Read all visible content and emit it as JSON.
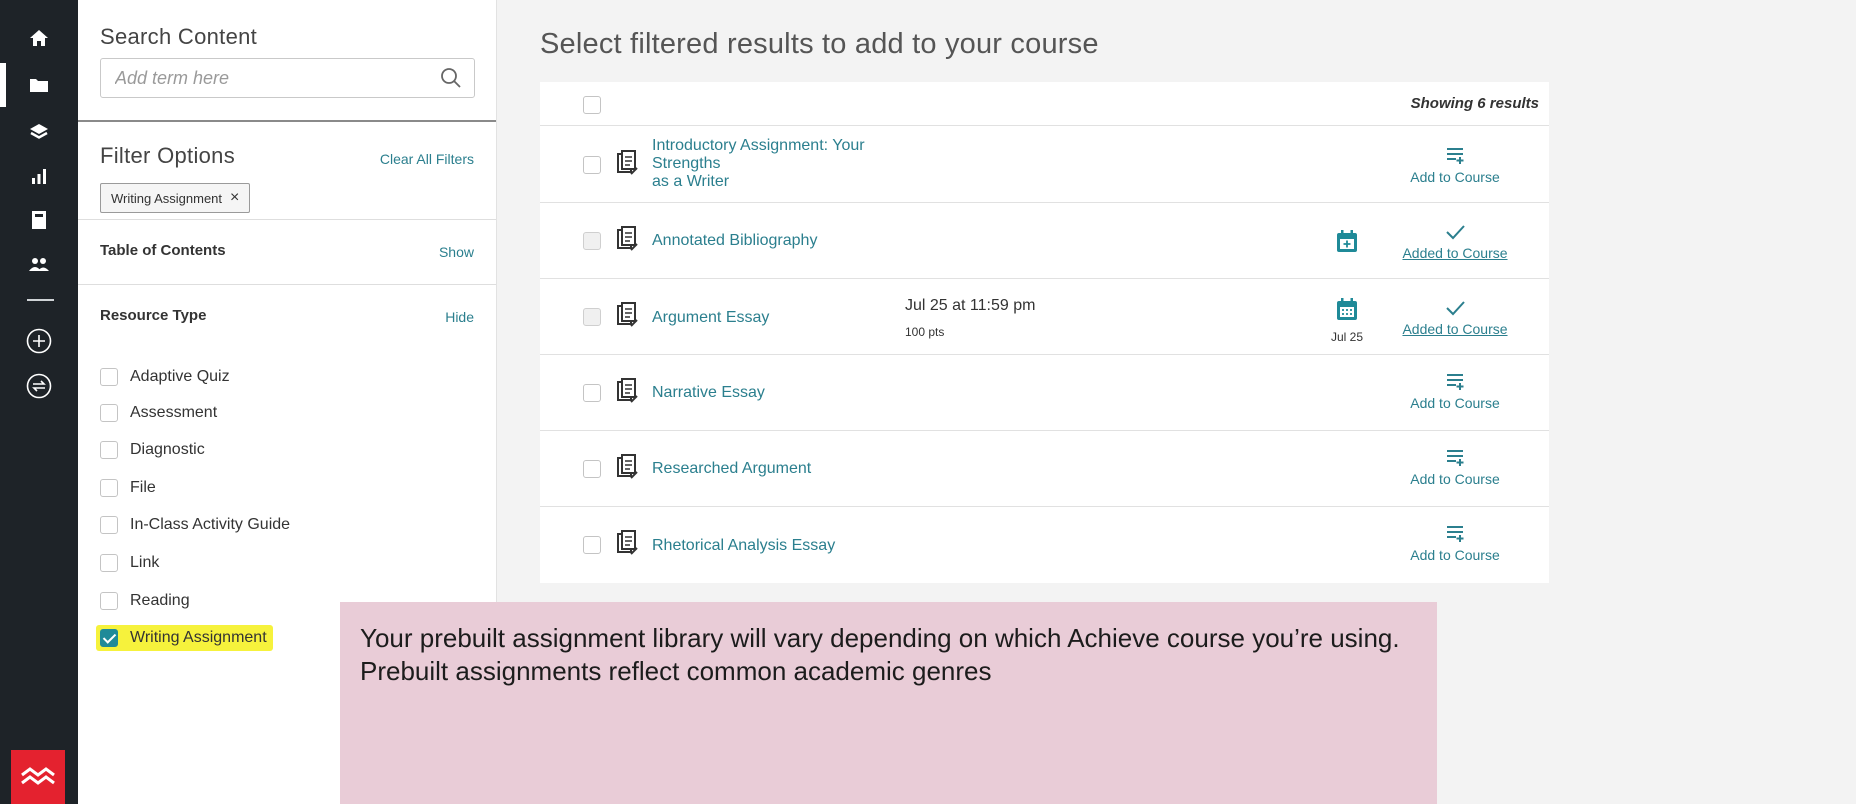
{
  "rail": {
    "icons": [
      "home-icon",
      "folder-icon",
      "layers-icon",
      "bar-chart-icon",
      "notebook-icon",
      "people-icon",
      "plus-circle-icon",
      "swap-circle-icon"
    ],
    "logo": "macmillan-logo-icon"
  },
  "search": {
    "label": "Search Content",
    "placeholder": "Add term here"
  },
  "filters": {
    "title": "Filter Options",
    "clear_label": "Clear All Filters",
    "active_chip": "Writing Assignment",
    "chip_remove": "×",
    "toc_title": "Table of Contents",
    "toc_toggle": "Show",
    "resource_title": "Resource Type",
    "resource_toggle": "Hide",
    "resource_types": [
      {
        "label": "Adaptive Quiz",
        "checked": false
      },
      {
        "label": "Assessment",
        "checked": false
      },
      {
        "label": "Diagnostic",
        "checked": false
      },
      {
        "label": "File",
        "checked": false
      },
      {
        "label": "In-Class Activity Guide",
        "checked": false
      },
      {
        "label": "Link",
        "checked": false
      },
      {
        "label": "Reading",
        "checked": false
      },
      {
        "label": "Writing Assignment",
        "checked": true
      }
    ]
  },
  "main": {
    "title": "Select filtered results to add to your course",
    "showing": "Showing 6 results",
    "rows": [
      {
        "title_lines": [
          "Introductory Assignment: Your",
          "Strengths",
          "as a Writer"
        ],
        "due": "",
        "pts": "",
        "calendar": false,
        "cal_date": "",
        "action": "Add to Course",
        "added": false
      },
      {
        "title_lines": [
          "Annotated Bibliography"
        ],
        "due": "",
        "pts": "",
        "calendar": true,
        "cal_date": "",
        "action": "Added to Course",
        "added": true
      },
      {
        "title_lines": [
          "Argument Essay"
        ],
        "due": "Jul 25 at 11:59 pm",
        "pts": "100 pts",
        "calendar": true,
        "cal_date": "Jul 25",
        "action": "Added to Course",
        "added": true
      },
      {
        "title_lines": [
          "Narrative Essay"
        ],
        "due": "",
        "pts": "",
        "calendar": false,
        "cal_date": "",
        "action": "Add to Course",
        "added": false
      },
      {
        "title_lines": [
          "Researched Argument"
        ],
        "due": "",
        "pts": "",
        "calendar": false,
        "cal_date": "",
        "action": "Add to Course",
        "added": false
      },
      {
        "title_lines": [
          "Rhetorical Analysis Essay"
        ],
        "due": "",
        "pts": "",
        "calendar": false,
        "cal_date": "",
        "action": "Add to Course",
        "added": false
      }
    ]
  },
  "callout": {
    "text": "Your prebuilt assignment library will vary depending on which Achieve course you’re using. Prebuilt assignments reflect common academic genres"
  },
  "colors": {
    "rail": "#1e2328",
    "accent": "#2b7f8e",
    "highlight": "#f6f23c",
    "callout": "#e9ccd7",
    "logo": "#e4222f"
  }
}
